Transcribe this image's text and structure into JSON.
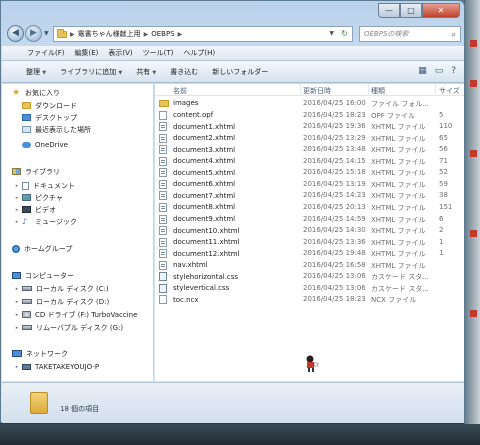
{
  "window": {
    "caption_min": "—",
    "caption_max": "□",
    "caption_close": "✕"
  },
  "address": {
    "back_icon": "◀",
    "forward_icon": "▶",
    "history_icon": "▼",
    "sep1": "▶",
    "crumb1": "電書ちゃん様献上用",
    "sep2": "▶",
    "crumb2": "OEBPS",
    "sep3": "▶",
    "dropdown_icon": "▼",
    "refresh_icon": "↻",
    "search_placeholder": "OEBPSの検索",
    "search_icon": "⌕"
  },
  "menu": {
    "items": [
      "ファイル(F)",
      "編集(E)",
      "表示(V)",
      "ツール(T)",
      "ヘルプ(H)"
    ]
  },
  "toolbar": {
    "organize": "整理",
    "add_to_library": "ライブラリに追加",
    "share": "共有",
    "burn": "書き込む",
    "new_folder": "新しいフォルダー",
    "arrow": "▼",
    "view_icon": "▦",
    "preview_icon": "▭",
    "help_icon": "?"
  },
  "nav": {
    "favorites": "お気に入り",
    "downloads": "ダウンロード",
    "desktop": "デスクトップ",
    "recent": "最近表示した場所",
    "onedrive": "OneDrive",
    "libraries": "ライブラリ",
    "documents": "ドキュメント",
    "pictures": "ピクチャ",
    "videos": "ビデオ",
    "music": "ミュージック",
    "homegroup": "ホームグループ",
    "computer": "コンピューター",
    "local_c": "ローカル ディスク (C:)",
    "local_d": "ローカル ディスク (D:)",
    "cd_f": "CD ドライブ (F:) TurboVaccine",
    "removable_g": "リムーバブル ディスク (G:)",
    "network": "ネットワーク",
    "net_pc": "TAKETAKEYOUJO-P",
    "caret_collapse": "▾",
    "caret_expand": "▸",
    "star_icon": "★",
    "music_icon": "♪"
  },
  "columns": {
    "name": "名前",
    "date": "更新日時",
    "type": "種類",
    "size": "サイズ"
  },
  "files": [
    {
      "name": "images",
      "date": "2016/04/25 16:00",
      "type": "ファイル フォル...",
      "size": "",
      "icon": "folder"
    },
    {
      "name": "content.opf",
      "date": "2016/04/25 18:23",
      "type": "OPF ファイル",
      "size": "5",
      "icon": "file"
    },
    {
      "name": "document1.xhtml",
      "date": "2016/04/25 19:36",
      "type": "XHTML ファイル",
      "size": "110",
      "icon": "xhtml"
    },
    {
      "name": "document2.xhtml",
      "date": "2016/04/25 13:29",
      "type": "XHTML ファイル",
      "size": "65",
      "icon": "xhtml"
    },
    {
      "name": "document3.xhtml",
      "date": "2016/04/25 13:48",
      "type": "XHTML ファイル",
      "size": "56",
      "icon": "xhtml"
    },
    {
      "name": "document4.xhtml",
      "date": "2016/04/25 14:15",
      "type": "XHTML ファイル",
      "size": "71",
      "icon": "xhtml"
    },
    {
      "name": "document5.xhtml",
      "date": "2016/04/25 15:18",
      "type": "XHTML ファイル",
      "size": "52",
      "icon": "xhtml"
    },
    {
      "name": "document6.xhtml",
      "date": "2016/04/25 13:19",
      "type": "XHTML ファイル",
      "size": "59",
      "icon": "xhtml"
    },
    {
      "name": "document7.xhtml",
      "date": "2016/04/25 14:23",
      "type": "XHTML ファイル",
      "size": "38",
      "icon": "xhtml"
    },
    {
      "name": "document8.xhtml",
      "date": "2016/04/25 20:13",
      "type": "XHTML ファイル",
      "size": "151",
      "icon": "xhtml"
    },
    {
      "name": "document9.xhtml",
      "date": "2016/04/25 14:59",
      "type": "XHTML ファイル",
      "size": "6",
      "icon": "xhtml"
    },
    {
      "name": "document10.xhtml",
      "date": "2016/04/25 14:30",
      "type": "XHTML ファイル",
      "size": "2",
      "icon": "xhtml"
    },
    {
      "name": "document11.xhtml",
      "date": "2016/04/25 13:36",
      "type": "XHTML ファイル",
      "size": "1",
      "icon": "xhtml"
    },
    {
      "name": "document12.xhtml",
      "date": "2016/04/25 19:48",
      "type": "XHTML ファイル",
      "size": "1",
      "icon": "xhtml"
    },
    {
      "name": "nav.xhtml",
      "date": "2016/04/25 16:58",
      "type": "XHTML ファイル",
      "size": "",
      "icon": "xhtml"
    },
    {
      "name": "stylehorizontal.css",
      "date": "2016/04/25 13:06",
      "type": "カスケード スタ...",
      "size": "",
      "icon": "css"
    },
    {
      "name": "stylevertical.css",
      "date": "2016/04/25 13:06",
      "type": "カスケード スタ...",
      "size": "",
      "icon": "css"
    },
    {
      "name": "toc.ncx",
      "date": "2016/04/25 18:23",
      "type": "NCX ファイル",
      "size": "",
      "icon": "file"
    }
  ],
  "status": {
    "item_count": "18 個の項目"
  },
  "colors": {
    "accent": "#2c6aad",
    "folder": "#e8c25a",
    "close_button": "#c0432c"
  }
}
